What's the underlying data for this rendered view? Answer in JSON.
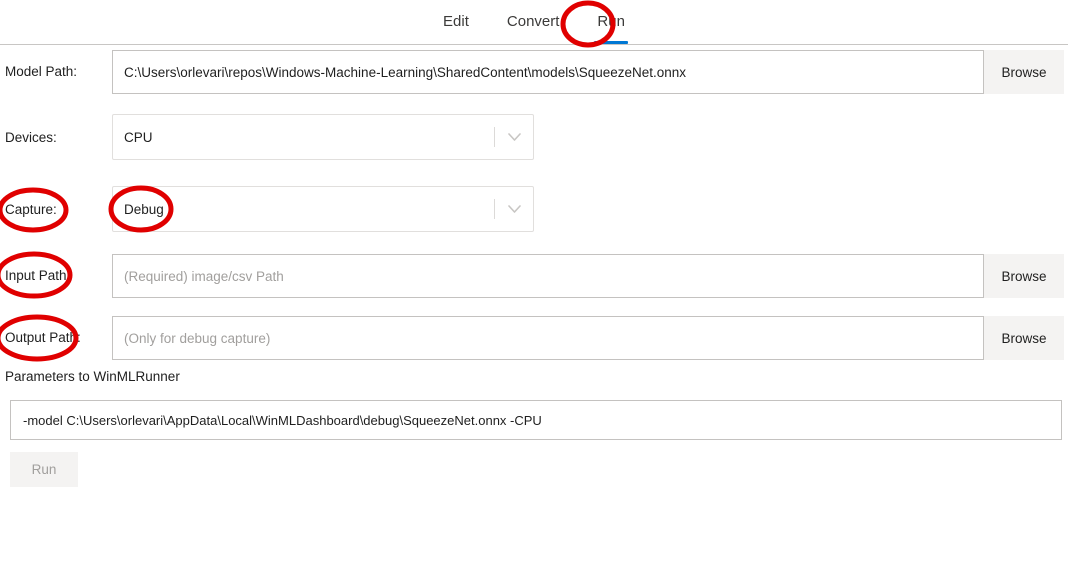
{
  "tabs": [
    {
      "label": "Edit",
      "active": false
    },
    {
      "label": "Convert",
      "active": false
    },
    {
      "label": "Run",
      "active": true
    }
  ],
  "form": {
    "model_path": {
      "label": "Model Path:",
      "value": "C:\\Users\\orlevari\\repos\\Windows-Machine-Learning\\SharedContent\\models\\SqueezeNet.onnx",
      "browse_label": "Browse"
    },
    "devices": {
      "label": "Devices:",
      "value": "CPU",
      "chevron_icon": "chevron-down-icon"
    },
    "capture": {
      "label": "Capture:",
      "value": "Debug",
      "chevron_icon": "chevron-down-icon"
    },
    "input_path": {
      "label": "Input Path:",
      "value": "",
      "placeholder": "(Required) image/csv Path",
      "browse_label": "Browse"
    },
    "output_path": {
      "label": "Output Path:",
      "value": "",
      "placeholder": "(Only for debug capture)",
      "browse_label": "Browse"
    }
  },
  "parameters": {
    "label": "Parameters to WinMLRunner",
    "value": "-model C:\\Users\\orlevari\\AppData\\Local\\WinMLDashboard\\debug\\SqueezeNet.onnx -CPU"
  },
  "run_button": {
    "label": "Run",
    "disabled": true
  },
  "annotations": {
    "color": "#e00000",
    "highlights": [
      "run-tab",
      "capture-label",
      "capture-value",
      "input-path-label",
      "output-path-label"
    ]
  }
}
